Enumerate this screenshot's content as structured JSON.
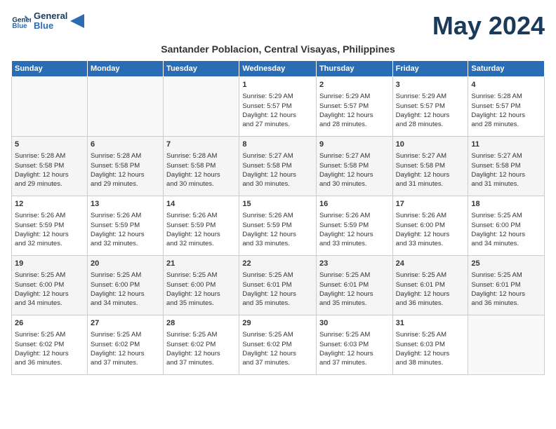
{
  "header": {
    "logo_line1": "General",
    "logo_line2": "Blue",
    "month_title": "May 2024",
    "subtitle": "Santander Poblacion, Central Visayas, Philippines"
  },
  "days_of_week": [
    "Sunday",
    "Monday",
    "Tuesday",
    "Wednesday",
    "Thursday",
    "Friday",
    "Saturday"
  ],
  "weeks": [
    [
      {
        "day": "",
        "info": ""
      },
      {
        "day": "",
        "info": ""
      },
      {
        "day": "",
        "info": ""
      },
      {
        "day": "1",
        "info": "Sunrise: 5:29 AM\nSunset: 5:57 PM\nDaylight: 12 hours\nand 27 minutes."
      },
      {
        "day": "2",
        "info": "Sunrise: 5:29 AM\nSunset: 5:57 PM\nDaylight: 12 hours\nand 28 minutes."
      },
      {
        "day": "3",
        "info": "Sunrise: 5:29 AM\nSunset: 5:57 PM\nDaylight: 12 hours\nand 28 minutes."
      },
      {
        "day": "4",
        "info": "Sunrise: 5:28 AM\nSunset: 5:57 PM\nDaylight: 12 hours\nand 28 minutes."
      }
    ],
    [
      {
        "day": "5",
        "info": "Sunrise: 5:28 AM\nSunset: 5:58 PM\nDaylight: 12 hours\nand 29 minutes."
      },
      {
        "day": "6",
        "info": "Sunrise: 5:28 AM\nSunset: 5:58 PM\nDaylight: 12 hours\nand 29 minutes."
      },
      {
        "day": "7",
        "info": "Sunrise: 5:28 AM\nSunset: 5:58 PM\nDaylight: 12 hours\nand 30 minutes."
      },
      {
        "day": "8",
        "info": "Sunrise: 5:27 AM\nSunset: 5:58 PM\nDaylight: 12 hours\nand 30 minutes."
      },
      {
        "day": "9",
        "info": "Sunrise: 5:27 AM\nSunset: 5:58 PM\nDaylight: 12 hours\nand 30 minutes."
      },
      {
        "day": "10",
        "info": "Sunrise: 5:27 AM\nSunset: 5:58 PM\nDaylight: 12 hours\nand 31 minutes."
      },
      {
        "day": "11",
        "info": "Sunrise: 5:27 AM\nSunset: 5:58 PM\nDaylight: 12 hours\nand 31 minutes."
      }
    ],
    [
      {
        "day": "12",
        "info": "Sunrise: 5:26 AM\nSunset: 5:59 PM\nDaylight: 12 hours\nand 32 minutes."
      },
      {
        "day": "13",
        "info": "Sunrise: 5:26 AM\nSunset: 5:59 PM\nDaylight: 12 hours\nand 32 minutes."
      },
      {
        "day": "14",
        "info": "Sunrise: 5:26 AM\nSunset: 5:59 PM\nDaylight: 12 hours\nand 32 minutes."
      },
      {
        "day": "15",
        "info": "Sunrise: 5:26 AM\nSunset: 5:59 PM\nDaylight: 12 hours\nand 33 minutes."
      },
      {
        "day": "16",
        "info": "Sunrise: 5:26 AM\nSunset: 5:59 PM\nDaylight: 12 hours\nand 33 minutes."
      },
      {
        "day": "17",
        "info": "Sunrise: 5:26 AM\nSunset: 6:00 PM\nDaylight: 12 hours\nand 33 minutes."
      },
      {
        "day": "18",
        "info": "Sunrise: 5:25 AM\nSunset: 6:00 PM\nDaylight: 12 hours\nand 34 minutes."
      }
    ],
    [
      {
        "day": "19",
        "info": "Sunrise: 5:25 AM\nSunset: 6:00 PM\nDaylight: 12 hours\nand 34 minutes."
      },
      {
        "day": "20",
        "info": "Sunrise: 5:25 AM\nSunset: 6:00 PM\nDaylight: 12 hours\nand 34 minutes."
      },
      {
        "day": "21",
        "info": "Sunrise: 5:25 AM\nSunset: 6:00 PM\nDaylight: 12 hours\nand 35 minutes."
      },
      {
        "day": "22",
        "info": "Sunrise: 5:25 AM\nSunset: 6:01 PM\nDaylight: 12 hours\nand 35 minutes."
      },
      {
        "day": "23",
        "info": "Sunrise: 5:25 AM\nSunset: 6:01 PM\nDaylight: 12 hours\nand 35 minutes."
      },
      {
        "day": "24",
        "info": "Sunrise: 5:25 AM\nSunset: 6:01 PM\nDaylight: 12 hours\nand 36 minutes."
      },
      {
        "day": "25",
        "info": "Sunrise: 5:25 AM\nSunset: 6:01 PM\nDaylight: 12 hours\nand 36 minutes."
      }
    ],
    [
      {
        "day": "26",
        "info": "Sunrise: 5:25 AM\nSunset: 6:02 PM\nDaylight: 12 hours\nand 36 minutes."
      },
      {
        "day": "27",
        "info": "Sunrise: 5:25 AM\nSunset: 6:02 PM\nDaylight: 12 hours\nand 37 minutes."
      },
      {
        "day": "28",
        "info": "Sunrise: 5:25 AM\nSunset: 6:02 PM\nDaylight: 12 hours\nand 37 minutes."
      },
      {
        "day": "29",
        "info": "Sunrise: 5:25 AM\nSunset: 6:02 PM\nDaylight: 12 hours\nand 37 minutes."
      },
      {
        "day": "30",
        "info": "Sunrise: 5:25 AM\nSunset: 6:03 PM\nDaylight: 12 hours\nand 37 minutes."
      },
      {
        "day": "31",
        "info": "Sunrise: 5:25 AM\nSunset: 6:03 PM\nDaylight: 12 hours\nand 38 minutes."
      },
      {
        "day": "",
        "info": ""
      }
    ]
  ]
}
